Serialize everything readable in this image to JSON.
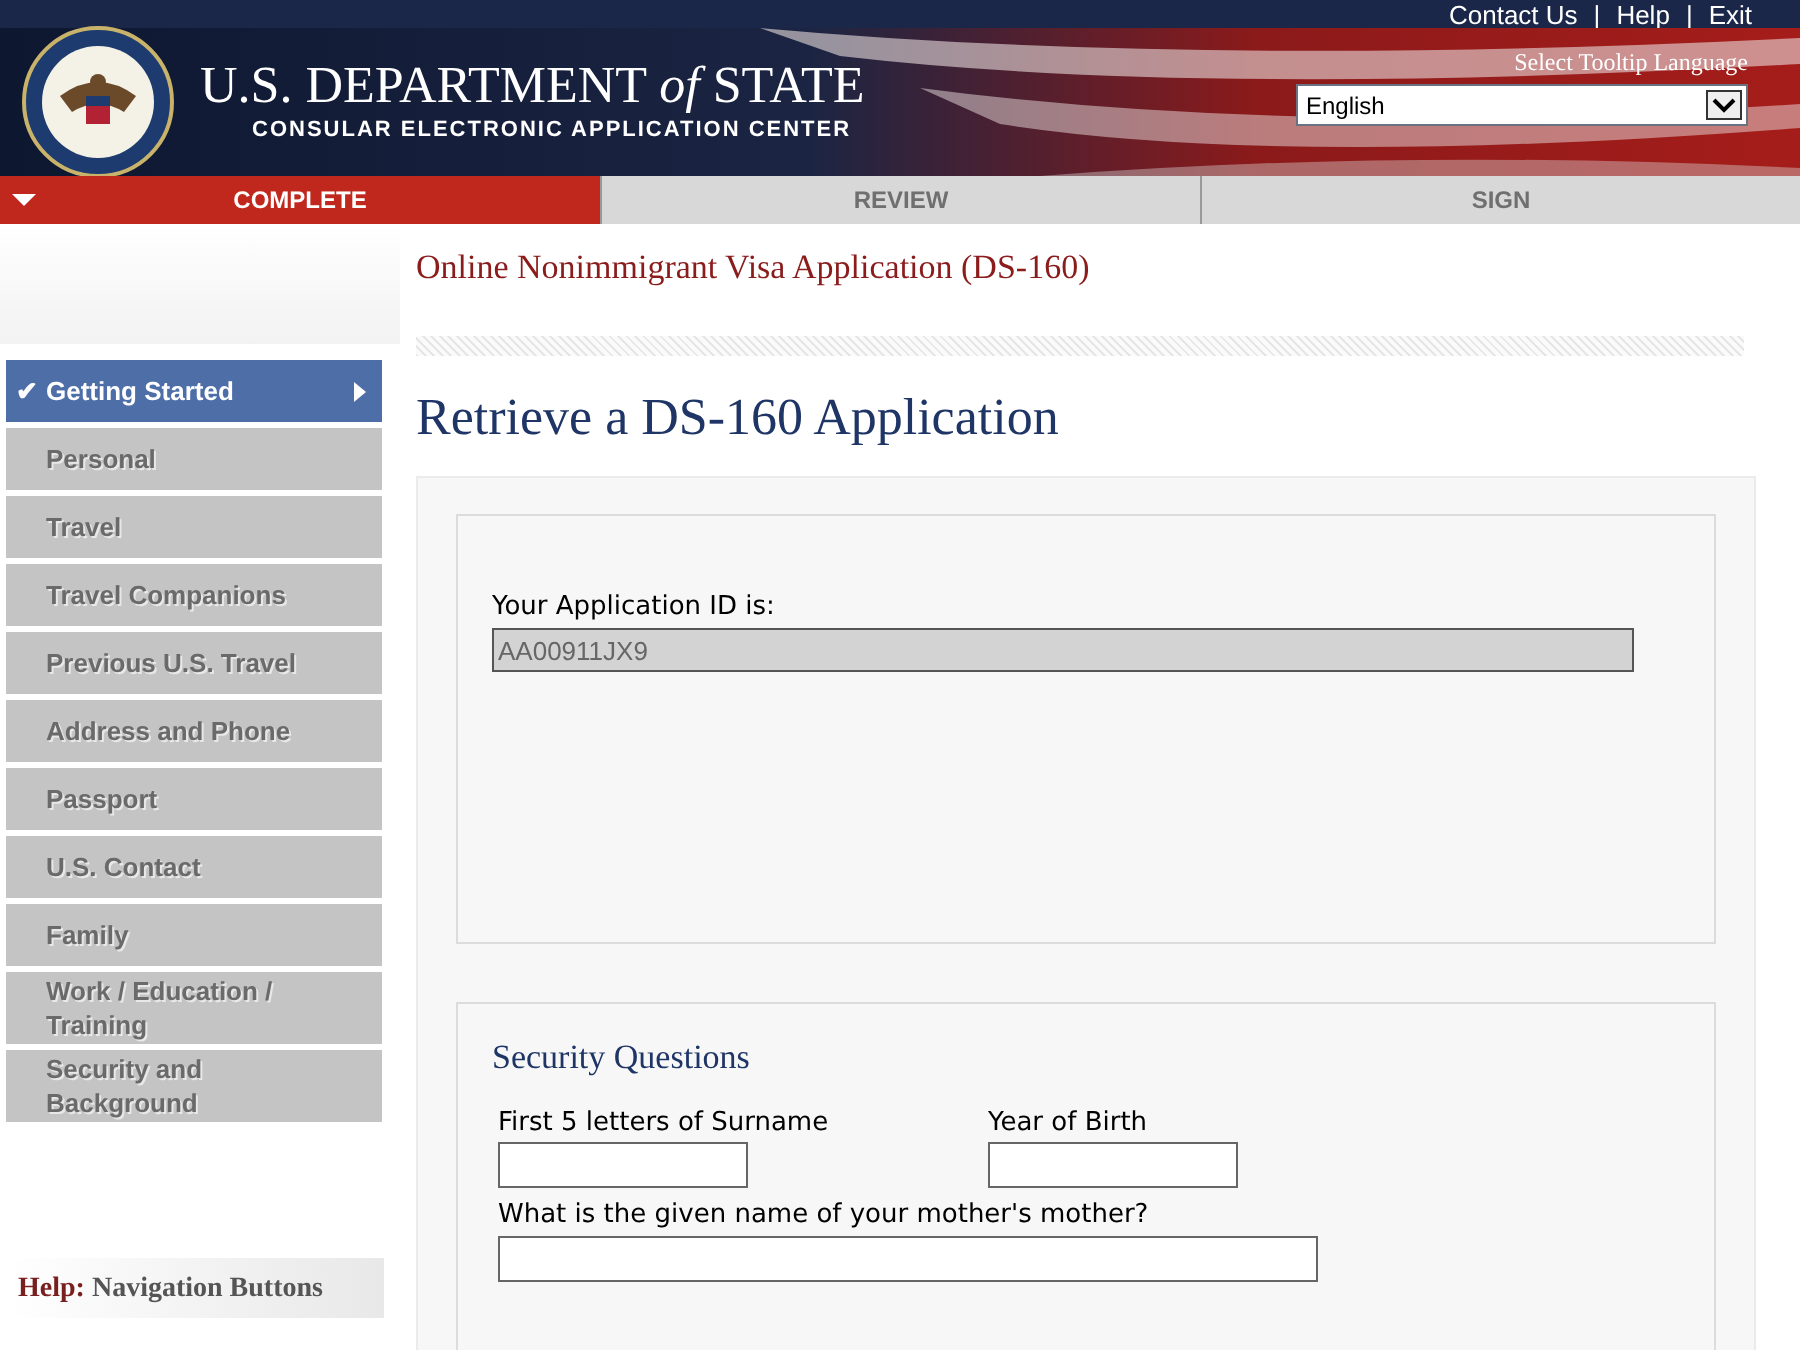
{
  "top_links": [
    "Contact Us",
    "Help",
    "Exit"
  ],
  "link_separator": "|",
  "header": {
    "title": "U.S. DEPARTMENT *of* STATE",
    "subtitle": "CONSULAR ELECTRONIC APPLICATION CENTER",
    "tooltip_label": "Select Tooltip Language",
    "language": "English"
  },
  "steps": [
    {
      "label": "COMPLETE",
      "selected": true
    },
    {
      "label": "REVIEW",
      "selected": false
    },
    {
      "label": "SIGN",
      "selected": false
    }
  ],
  "form_title": "Online Nonimmigrant Visa Application (DS-160)",
  "sidebar": {
    "check": "✔",
    "items": [
      {
        "label": "Getting Started",
        "selected": true,
        "disabled": false
      },
      {
        "label": "Personal",
        "selected": false,
        "disabled": true
      },
      {
        "label": "Travel",
        "selected": false,
        "disabled": true
      },
      {
        "label": "Travel Companions",
        "selected": false,
        "disabled": true
      },
      {
        "label": "Previous U.S. Travel",
        "selected": false,
        "disabled": true
      },
      {
        "label": "Address and Phone",
        "selected": false,
        "disabled": true
      },
      {
        "label": "Passport",
        "selected": false,
        "disabled": true
      },
      {
        "label": "U.S. Contact",
        "selected": false,
        "disabled": true
      },
      {
        "label": "Family",
        "selected": false,
        "disabled": true
      },
      {
        "label": "Work / Education / Training",
        "selected": false,
        "disabled": true
      },
      {
        "label": "Security and Background",
        "selected": false,
        "disabled": true
      }
    ],
    "help": {
      "label": "Help:",
      "text": "Navigation Buttons"
    }
  },
  "page_title": "Retrieve a DS-160 Application",
  "application_id": {
    "label": "Your Application ID is:",
    "value": "AA00911JX9",
    "disabled": true
  },
  "security": {
    "title": "Security Questions",
    "fields": [
      {
        "label": "First 5 letters of Surname"
      },
      {
        "label": "Year of Birth"
      },
      {
        "label": "What is the given name of your mother's mother?"
      }
    ]
  }
}
